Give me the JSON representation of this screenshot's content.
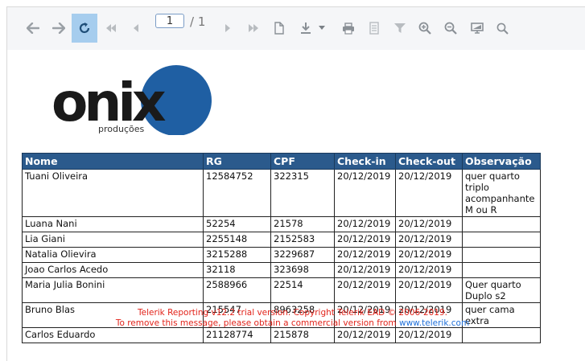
{
  "toolbar": {
    "page_current": "1",
    "page_total": "/ 1",
    "icons": [
      "back-icon",
      "forward-icon",
      "refresh-icon",
      "first-page-icon",
      "previous-page-icon",
      "next-page-icon",
      "last-page-icon",
      "document-map-icon",
      "export-icon",
      "export-dropdown-icon",
      "print-icon",
      "print-preview-icon",
      "parameters-filter-icon",
      "zoom-in-icon",
      "zoom-out-icon",
      "toggle-view-icon",
      "search-icon"
    ]
  },
  "logo": {
    "text": "onix",
    "subtext": "produções",
    "colors": {
      "dark": "#1a1a1a",
      "blue": "#1f5fa3"
    }
  },
  "table": {
    "headers": [
      "Nome",
      "RG",
      "CPF",
      "Check-in",
      "Check-out",
      "Observação"
    ],
    "rows": [
      [
        "Tuani Oliveira",
        "12584752",
        "322315",
        "20/12/2019",
        "20/12/2019",
        "quer quarto triplo acompanhante M ou R"
      ],
      [
        "Luana Nani",
        "52254",
        "21578",
        "20/12/2019",
        "20/12/2019",
        ""
      ],
      [
        "Lia Giani",
        "2255148",
        "2152583",
        "20/12/2019",
        "20/12/2019",
        ""
      ],
      [
        "Natalia Olievira",
        "3215288",
        "3229687",
        "20/12/2019",
        "20/12/2019",
        ""
      ],
      [
        "Joao Carlos Acedo",
        "32118",
        "323698",
        "20/12/2019",
        "20/12/2019",
        ""
      ],
      [
        "Maria Julia Bonini",
        "2588966",
        "22514",
        "20/12/2019",
        "20/12/2019",
        "Quer quarto Duplo s2"
      ],
      [
        "Bruno Blas",
        "215547",
        "8963258",
        "20/12/2019",
        "20/12/2019",
        "quer cama extra"
      ],
      [
        "Carlos Eduardo",
        "21128774",
        "215878",
        "20/12/2019",
        "20/12/2019",
        ""
      ]
    ]
  },
  "trial_notice": {
    "line1": "Telerik Reporting v12.2 trial version. Copyright Telerik EAD © 2006-2019.",
    "line2_prefix": "To remove this message, please obtain a commercial version from ",
    "link": "www.telerik.com"
  },
  "colors": {
    "header_bg": "#2b5a8c",
    "trial_text": "#e2231a",
    "active_button": "#a6cdee"
  }
}
